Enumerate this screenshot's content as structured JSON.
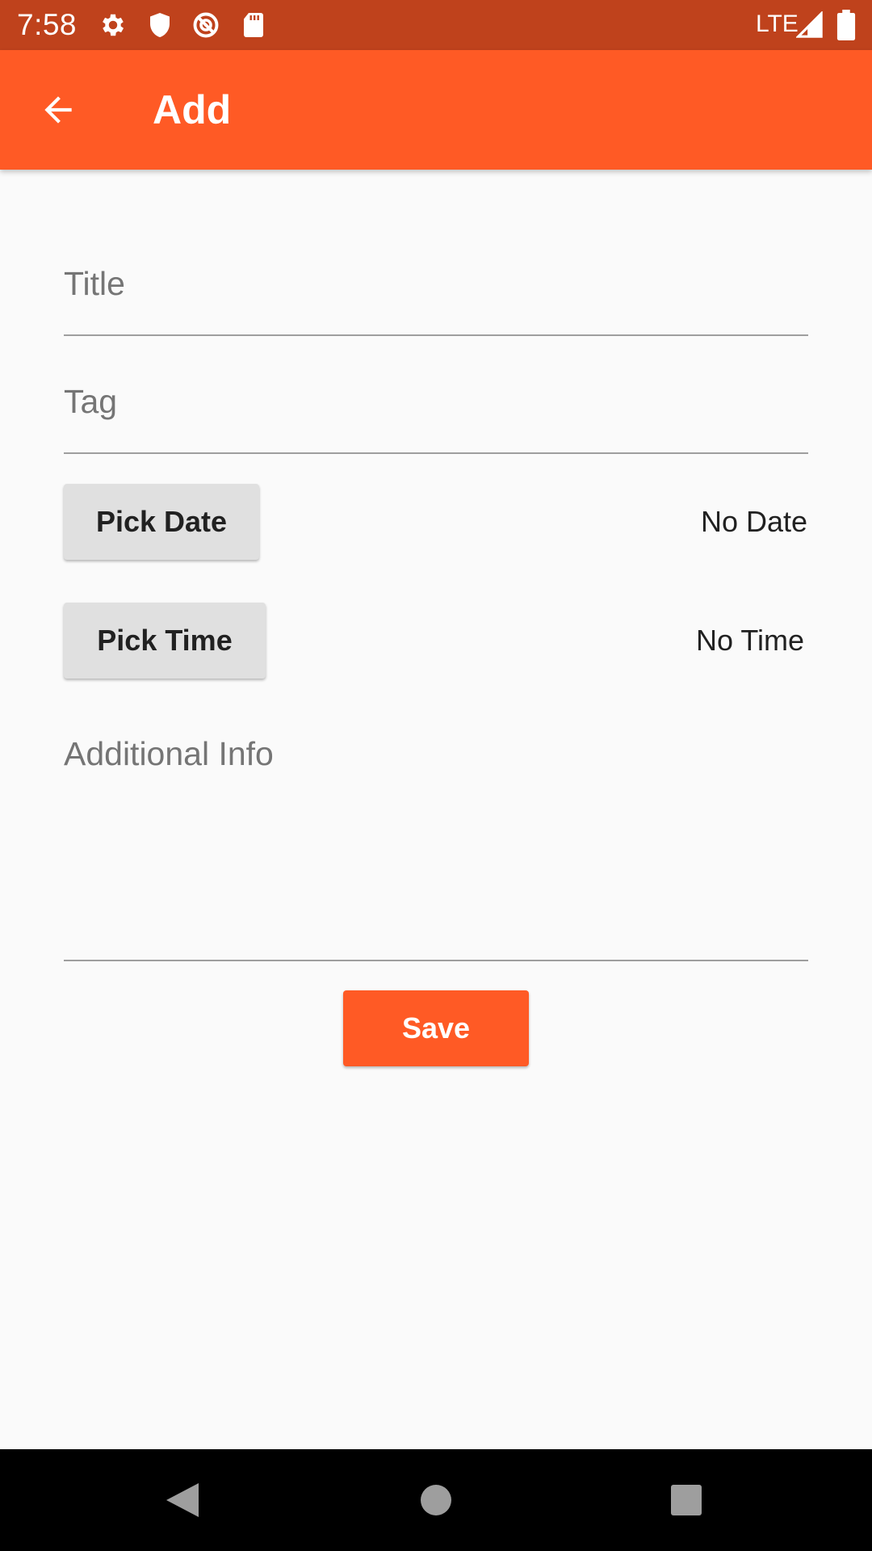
{
  "status_bar": {
    "time": "7:58",
    "network": "LTE",
    "icons": [
      "gear-icon",
      "shield-icon",
      "no-data-icon",
      "sd-card-icon",
      "signal-icon",
      "battery-icon"
    ]
  },
  "app_bar": {
    "title": "Add",
    "back_icon": "arrow-back-icon"
  },
  "form": {
    "title_placeholder": "Title",
    "tag_placeholder": "Tag",
    "pick_date_label": "Pick Date",
    "date_value": "No Date",
    "pick_time_label": "Pick Time",
    "time_value": "No Time",
    "additional_info_placeholder": "Additional Info",
    "save_label": "Save"
  },
  "nav_bar": {
    "icons": [
      "back-triangle-icon",
      "home-circle-icon",
      "recents-square-icon"
    ]
  },
  "colors": {
    "status_bar": "#bf421c",
    "accent": "#ff5a25",
    "button_grey": "#e0e0e0",
    "background": "#fafafa"
  }
}
